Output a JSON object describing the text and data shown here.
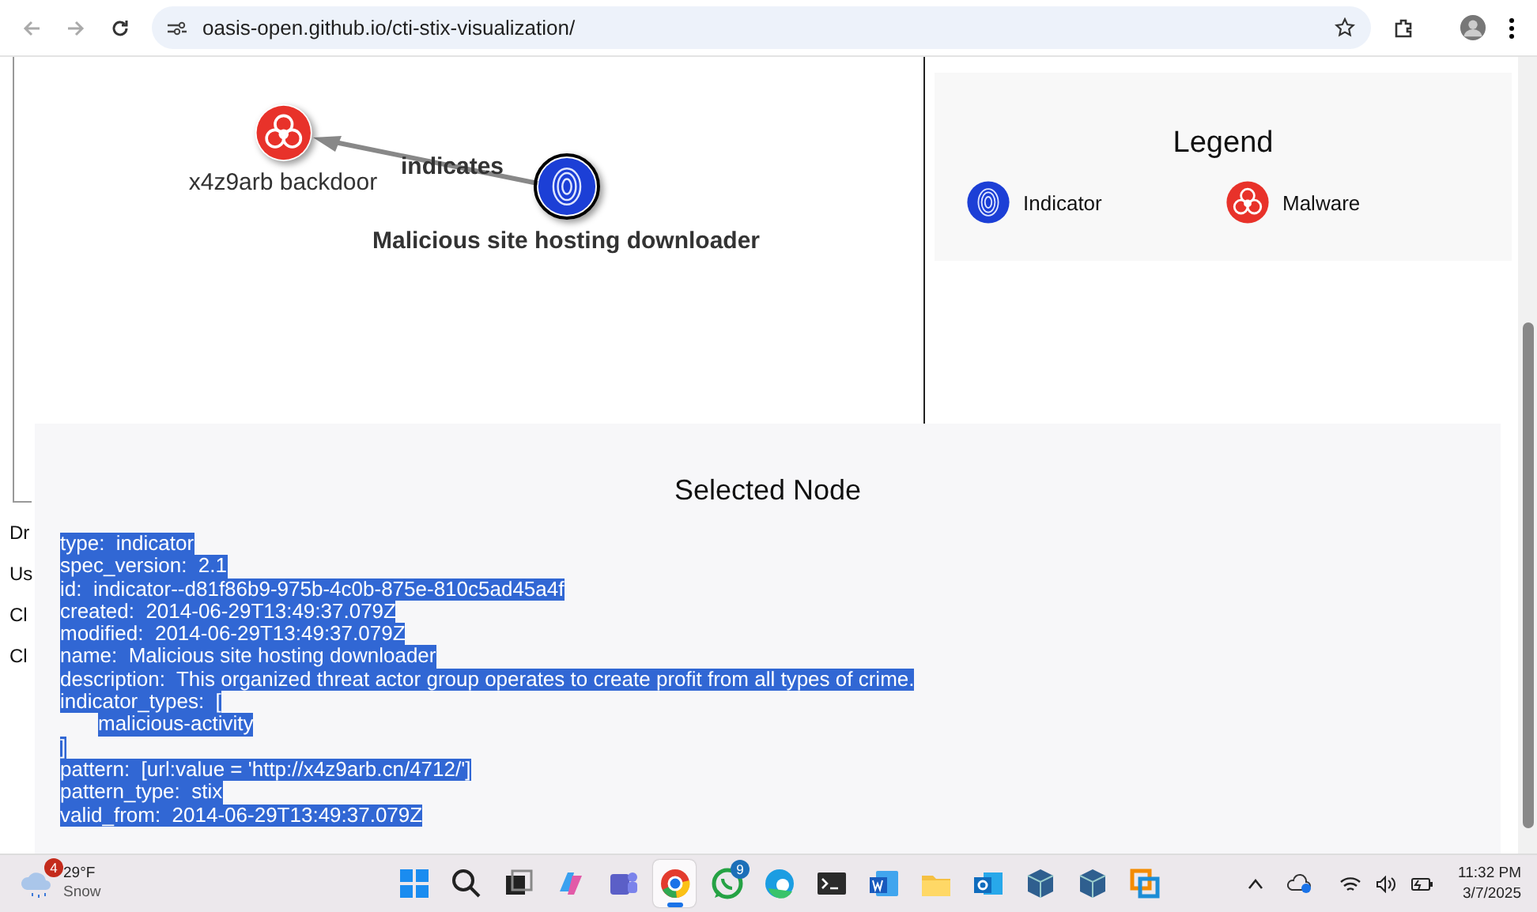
{
  "browser": {
    "url": "oasis-open.github.io/cti-stix-visualization/"
  },
  "graph": {
    "nodes": [
      {
        "kind": "malware",
        "label": "x4z9arb backdoor",
        "selected": false
      },
      {
        "kind": "indicator",
        "label": "Malicious site hosting downloader",
        "selected": true
      }
    ],
    "edges": [
      {
        "label": "indicates"
      }
    ]
  },
  "legend": {
    "title": "Legend",
    "items": [
      {
        "kind": "indicator",
        "label": "Indicator"
      },
      {
        "kind": "malware",
        "label": "Malware"
      }
    ]
  },
  "page_text": [
    "Dr",
    "Us",
    "Cl",
    "Cl"
  ],
  "selected_node": {
    "title": "Selected Node",
    "highlighted": true,
    "lines": [
      {
        "kind": "field",
        "key": "type:",
        "value": "indicator"
      },
      {
        "kind": "field",
        "key": "spec_version:",
        "value": "2.1"
      },
      {
        "kind": "field",
        "key": "id:",
        "value": "indicator--d81f86b9-975b-4c0b-875e-810c5ad45a4f"
      },
      {
        "kind": "field",
        "key": "created:",
        "value": "2014-06-29T13:49:37.079Z"
      },
      {
        "kind": "field",
        "key": "modified:",
        "value": "2014-06-29T13:49:37.079Z"
      },
      {
        "kind": "field",
        "key": "name:",
        "value": "Malicious site hosting downloader"
      },
      {
        "kind": "field",
        "key": "description:",
        "value": "This organized threat actor group operates to create profit from all types of crime."
      },
      {
        "kind": "field",
        "key": "indicator_types:",
        "value": "["
      },
      {
        "kind": "item",
        "value": "malicious-activity"
      },
      {
        "kind": "bracket",
        "value": "]"
      },
      {
        "kind": "field",
        "key": "pattern:",
        "value": "[url:value = 'http://x4z9arb.cn/4712/']"
      },
      {
        "kind": "field",
        "key": "pattern_type:",
        "value": "stix"
      },
      {
        "kind": "field",
        "key": "valid_from:",
        "value": "2014-06-29T13:49:37.079Z"
      }
    ]
  },
  "taskbar": {
    "weather": {
      "badge": "4",
      "temperature": "29°F",
      "condition": "Snow"
    },
    "apps": [
      {
        "kind": "start",
        "active": false
      },
      {
        "kind": "search",
        "active": false
      },
      {
        "kind": "taskview",
        "active": false
      },
      {
        "kind": "copilot",
        "active": false
      },
      {
        "kind": "teams",
        "active": false
      },
      {
        "kind": "chrome",
        "active": true
      },
      {
        "kind": "whatsapp",
        "active": false,
        "badge": "9"
      },
      {
        "kind": "edge",
        "active": false
      },
      {
        "kind": "terminal",
        "active": false
      },
      {
        "kind": "word",
        "active": false
      },
      {
        "kind": "files",
        "active": false
      },
      {
        "kind": "outlook",
        "active": false
      },
      {
        "kind": "vbox",
        "active": false
      },
      {
        "kind": "vbox",
        "active": false
      },
      {
        "kind": "vmware",
        "active": false
      }
    ],
    "time": "11:32 PM",
    "date": "3/7/2025"
  }
}
